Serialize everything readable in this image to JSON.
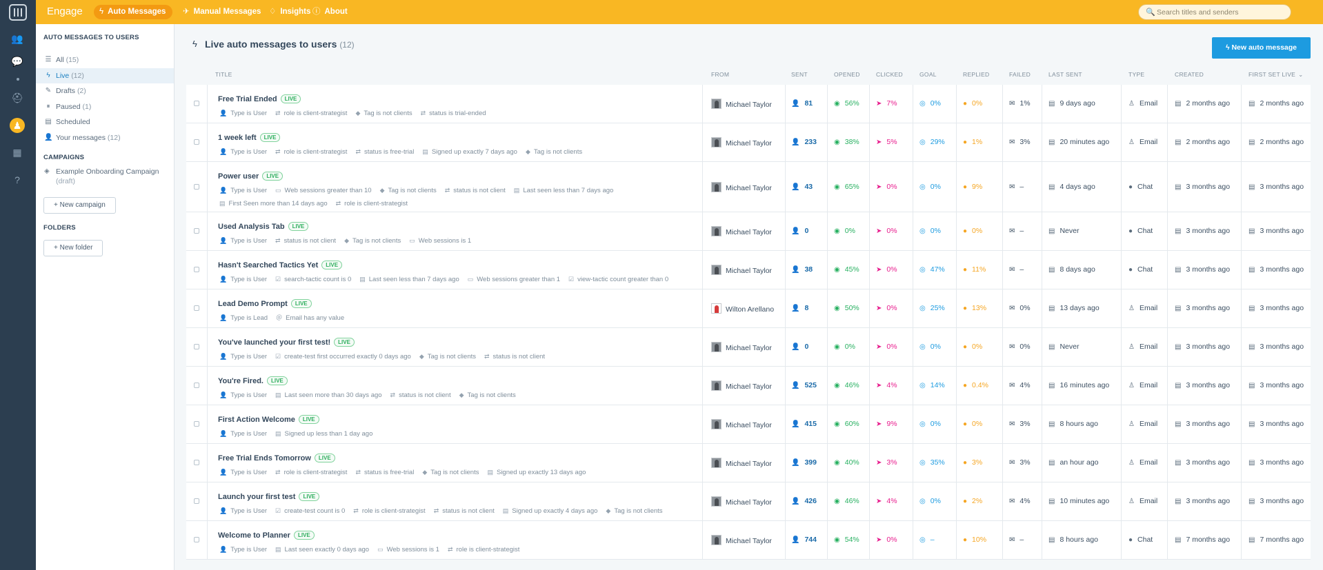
{
  "app": {
    "brand": "Engage"
  },
  "topnav": [
    {
      "icon": "bolt-icon",
      "glyph": "ϟ",
      "label": "Auto Messages",
      "active": true
    },
    {
      "icon": "send-icon",
      "glyph": "✈",
      "label": "Manual Messages",
      "active": false
    },
    {
      "icon": "lightbulb-icon",
      "glyph": "♢",
      "label": "Insights",
      "active": false
    },
    {
      "icon": "info-icon",
      "glyph": "ⓘ",
      "label": "About",
      "active": false
    }
  ],
  "search": {
    "placeholder": "Search titles and senders"
  },
  "sidebar": {
    "heading": "AUTO MESSAGES TO USERS",
    "items": [
      {
        "icon": "list-icon",
        "glyph": "☰",
        "label": "All",
        "count": "(15)"
      },
      {
        "icon": "bolt-icon",
        "glyph": "ϟ",
        "label": "Live",
        "count": "(12)"
      },
      {
        "icon": "pencil-icon",
        "glyph": "✎",
        "label": "Drafts",
        "count": "(2)"
      },
      {
        "icon": "pause-icon",
        "glyph": "⏸",
        "label": "Paused",
        "count": "(1)"
      },
      {
        "icon": "calendar-icon",
        "glyph": "▤",
        "label": "Scheduled",
        "count": ""
      },
      {
        "icon": "user-icon",
        "glyph": "👤",
        "label": "Your messages",
        "count": "(12)"
      }
    ],
    "campaigns_heading": "CAMPAIGNS",
    "campaign": {
      "name": "Example Onboarding Campaign",
      "status": "(draft)"
    },
    "new_campaign": "+ New campaign",
    "folders_heading": "FOLDERS",
    "new_folder": "+ New folder"
  },
  "main": {
    "title": "Live auto messages to users",
    "count": "(12)",
    "new_button": "ϟ  New auto message",
    "columns": [
      "TITLE",
      "FROM",
      "SENT",
      "OPENED",
      "CLICKED",
      "GOAL",
      "REPLIED",
      "FAILED",
      "LAST SENT",
      "TYPE",
      "CREATED",
      "FIRST SET LIVE"
    ],
    "live_badge": "LIVE"
  },
  "rows": [
    {
      "title": "Free Trial Ended",
      "rules": [
        [
          "👤",
          "Type is User"
        ],
        [
          "⇄",
          "role is client-strategist"
        ],
        [
          "◆",
          "Tag is not clients"
        ],
        [
          "⇄",
          "status is trial-ended"
        ]
      ],
      "from": "Michael Taylor",
      "avatar": "photo",
      "sent": "81",
      "opened": "56%",
      "clicked": "7%",
      "goal": "0%",
      "replied": "0%",
      "failed": "1%",
      "last_sent": "9 days ago",
      "type": "Email",
      "created": "2 months ago",
      "first_live": "2 months ago"
    },
    {
      "title": "1 week left",
      "rules": [
        [
          "👤",
          "Type is User"
        ],
        [
          "⇄",
          "role is client-strategist"
        ],
        [
          "⇄",
          "status is free-trial"
        ],
        [
          "▤",
          "Signed up exactly 7 days ago"
        ],
        [
          "◆",
          "Tag is not clients"
        ]
      ],
      "from": "Michael Taylor",
      "avatar": "photo",
      "sent": "233",
      "opened": "38%",
      "clicked": "5%",
      "goal": "29%",
      "replied": "1%",
      "failed": "3%",
      "last_sent": "20 minutes ago",
      "type": "Email",
      "created": "2 months ago",
      "first_live": "2 months ago"
    },
    {
      "title": "Power user",
      "rules": [
        [
          "👤",
          "Type is User"
        ],
        [
          "▭",
          "Web sessions greater than 10"
        ],
        [
          "◆",
          "Tag is not clients"
        ],
        [
          "⇄",
          "status is not client"
        ],
        [
          "▤",
          "Last seen less than 7 days ago"
        ],
        [
          "▤",
          "First Seen more than 14 days ago"
        ],
        [
          "⇄",
          "role is client-strategist"
        ]
      ],
      "from": "Michael Taylor",
      "avatar": "photo",
      "sent": "43",
      "opened": "65%",
      "clicked": "0%",
      "goal": "0%",
      "replied": "9%",
      "failed": "–",
      "last_sent": "4 days ago",
      "type": "Chat",
      "created": "3 months ago",
      "first_live": "3 months ago"
    },
    {
      "title": "Used Analysis Tab",
      "rules": [
        [
          "👤",
          "Type is User"
        ],
        [
          "⇄",
          "status is not client"
        ],
        [
          "◆",
          "Tag is not clients"
        ],
        [
          "▭",
          "Web sessions is 1"
        ]
      ],
      "from": "Michael Taylor",
      "avatar": "photo",
      "sent": "0",
      "opened": "0%",
      "clicked": "0%",
      "goal": "0%",
      "replied": "0%",
      "failed": "–",
      "last_sent": "Never",
      "type": "Chat",
      "created": "3 months ago",
      "first_live": "3 months ago"
    },
    {
      "title": "Hasn't Searched Tactics Yet",
      "rules": [
        [
          "👤",
          "Type is User"
        ],
        [
          "☑",
          "search-tactic count is 0"
        ],
        [
          "▤",
          "Last seen less than 7 days ago"
        ],
        [
          "▭",
          "Web sessions greater than 1"
        ],
        [
          "☑",
          "view-tactic count greater than 0"
        ]
      ],
      "from": "Michael Taylor",
      "avatar": "photo",
      "sent": "38",
      "opened": "45%",
      "clicked": "0%",
      "goal": "47%",
      "replied": "11%",
      "failed": "–",
      "last_sent": "8 days ago",
      "type": "Chat",
      "created": "3 months ago",
      "first_live": "3 months ago"
    },
    {
      "title": "Lead Demo Prompt",
      "rules": [
        [
          "👤",
          "Type is Lead"
        ],
        [
          "＠",
          "Email has any value"
        ]
      ],
      "from": "Wilton Arellano",
      "avatar": "red",
      "sent": "8",
      "opened": "50%",
      "clicked": "0%",
      "goal": "25%",
      "replied": "13%",
      "failed": "0%",
      "last_sent": "13 days ago",
      "type": "Email",
      "created": "3 months ago",
      "first_live": "3 months ago"
    },
    {
      "title": "You've launched your first test!",
      "rules": [
        [
          "👤",
          "Type is User"
        ],
        [
          "☑",
          "create-test first occurred exactly 0 days ago"
        ],
        [
          "◆",
          "Tag is not clients"
        ],
        [
          "⇄",
          "status is not client"
        ]
      ],
      "from": "Michael Taylor",
      "avatar": "photo",
      "sent": "0",
      "opened": "0%",
      "clicked": "0%",
      "goal": "0%",
      "replied": "0%",
      "failed": "0%",
      "last_sent": "Never",
      "type": "Email",
      "created": "3 months ago",
      "first_live": "3 months ago"
    },
    {
      "title": "You're Fired.",
      "rules": [
        [
          "👤",
          "Type is User"
        ],
        [
          "▤",
          "Last seen more than 30 days ago"
        ],
        [
          "⇄",
          "status is not client"
        ],
        [
          "◆",
          "Tag is not clients"
        ]
      ],
      "from": "Michael Taylor",
      "avatar": "photo",
      "sent": "525",
      "opened": "46%",
      "clicked": "4%",
      "goal": "14%",
      "replied": "0.4%",
      "failed": "4%",
      "last_sent": "16 minutes ago",
      "type": "Email",
      "created": "3 months ago",
      "first_live": "3 months ago"
    },
    {
      "title": "First Action Welcome",
      "rules": [
        [
          "👤",
          "Type is User"
        ],
        [
          "▤",
          "Signed up less than 1 day ago"
        ]
      ],
      "from": "Michael Taylor",
      "avatar": "photo",
      "sent": "415",
      "opened": "60%",
      "clicked": "9%",
      "goal": "0%",
      "replied": "0%",
      "failed": "3%",
      "last_sent": "8 hours ago",
      "type": "Email",
      "created": "3 months ago",
      "first_live": "3 months ago"
    },
    {
      "title": "Free Trial Ends Tomorrow",
      "rules": [
        [
          "👤",
          "Type is User"
        ],
        [
          "⇄",
          "role is client-strategist"
        ],
        [
          "⇄",
          "status is free-trial"
        ],
        [
          "◆",
          "Tag is not clients"
        ],
        [
          "▤",
          "Signed up exactly 13 days ago"
        ]
      ],
      "from": "Michael Taylor",
      "avatar": "photo",
      "sent": "399",
      "opened": "40%",
      "clicked": "3%",
      "goal": "35%",
      "replied": "3%",
      "failed": "3%",
      "last_sent": "an hour ago",
      "type": "Email",
      "created": "3 months ago",
      "first_live": "3 months ago"
    },
    {
      "title": "Launch your first test",
      "rules": [
        [
          "👤",
          "Type is User"
        ],
        [
          "☑",
          "create-test count is 0"
        ],
        [
          "⇄",
          "role is client-strategist"
        ],
        [
          "⇄",
          "status is not client"
        ],
        [
          "▤",
          "Signed up exactly 4 days ago"
        ],
        [
          "◆",
          "Tag is not clients"
        ]
      ],
      "from": "Michael Taylor",
      "avatar": "photo",
      "sent": "426",
      "opened": "46%",
      "clicked": "4%",
      "goal": "0%",
      "replied": "2%",
      "failed": "4%",
      "last_sent": "10 minutes ago",
      "type": "Email",
      "created": "3 months ago",
      "first_live": "3 months ago"
    },
    {
      "title": "Welcome to Planner",
      "rules": [
        [
          "👤",
          "Type is User"
        ],
        [
          "▤",
          "Last seen exactly 0 days ago"
        ],
        [
          "▭",
          "Web sessions is 1"
        ],
        [
          "⇄",
          "role is client-strategist"
        ]
      ],
      "from": "Michael Taylor",
      "avatar": "photo",
      "sent": "744",
      "opened": "54%",
      "clicked": "0%",
      "goal": "–",
      "replied": "10%",
      "failed": "–",
      "last_sent": "8 hours ago",
      "type": "Chat",
      "created": "7 months ago",
      "first_live": "7 months ago"
    }
  ],
  "colors": {
    "topbar": "#f9b723",
    "accent": "#1d9be0",
    "live": "#2dae5d",
    "opened": "#27b060",
    "clicked": "#e81c8d",
    "replied": "#f5a623"
  }
}
